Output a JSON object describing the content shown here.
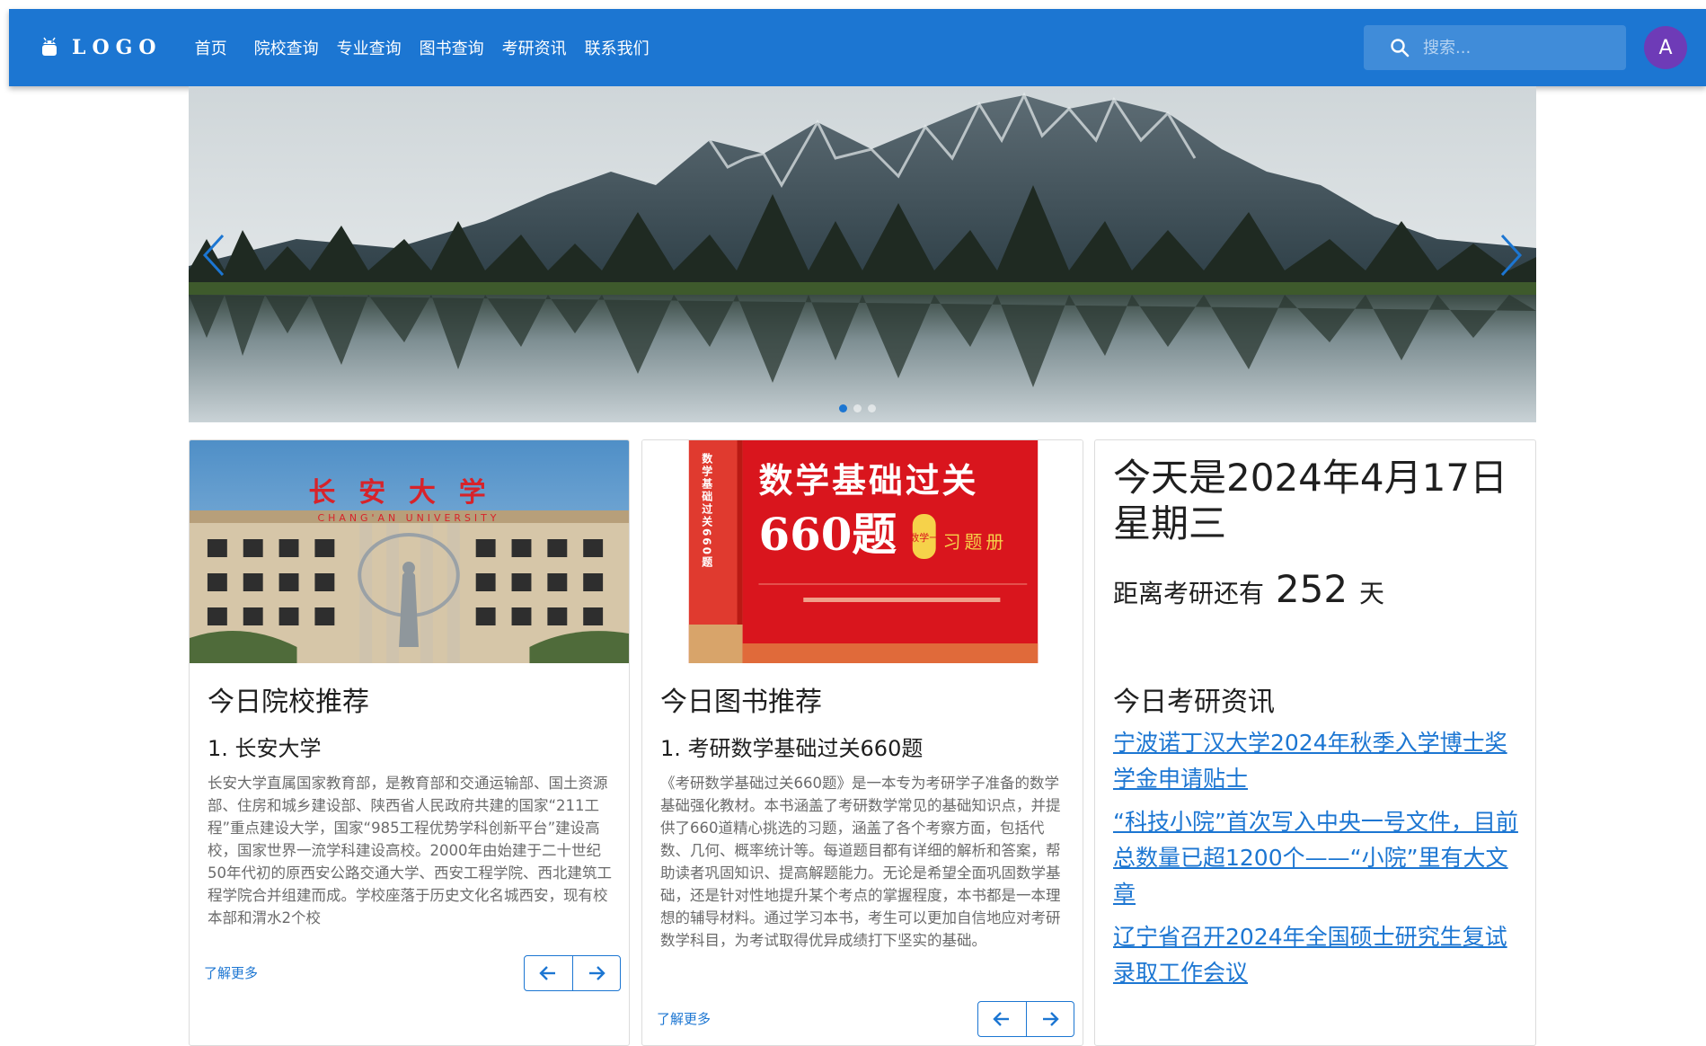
{
  "header": {
    "logo_text": "LOGO",
    "nav": [
      "首页",
      "院校查询",
      "专业查询",
      "图书查询",
      "考研资讯",
      "联系我们"
    ],
    "search_placeholder": "搜索...",
    "avatar_initial": "A"
  },
  "carousel": {
    "slide_count": 3,
    "active_slide": 1
  },
  "school_card": {
    "title": "今日院校推荐",
    "item_title": "1. 长安大学",
    "sign_text": "长安大学",
    "sign_text_en": "CHANG'AN UNIVERSITY",
    "description": "长安大学直属国家教育部，是教育部和交通运输部、国土资源部、住房和城乡建设部、陕西省人民政府共建的国家“211工程”重点建设大学，国家“985工程优势学科创新平台”建设高校，国家世界一流学科建设高校。2000年由始建于二十世纪50年代初的原西安公路交通大学、西安工程学院、西北建筑工程学院合并组建而成。学校座落于历史文化名城西安，现有校本部和渭水2个校",
    "more": "了解更多"
  },
  "book_card": {
    "title": "今日图书推荐",
    "item_title": "1. 考研数学基础过关660题",
    "cover_title": "数学基础过关",
    "cover_number": "660题",
    "cover_badge": "数学一",
    "cover_subtitle": "习题册",
    "spine_text": "数学基础过关660题",
    "description": "《考研数学基础过关660题》是一本专为考研学子准备的数学基础强化教材。本书涵盖了考研数学常见的基础知识点，并提供了660道精心挑选的习题，涵盖了各个考察方面，包括代数、几何、概率统计等。每道题目都有详细的解析和答案，帮助读者巩固知识、提高解题能力。无论是希望全面巩固数学基础，还是针对性地提升某个考点的掌握程度，本书都是一本理想的辅导材料。通过学习本书，考生可以更加自信地应对考研数学科目，为考试取得优异成绩打下坚实的基础。",
    "more": "了解更多"
  },
  "info_card": {
    "date_text": "今天是2024年4月17日 星期三",
    "countdown_prefix": "距离考研还有",
    "countdown_days": "252",
    "countdown_suffix": "天",
    "news_title": "今日考研资讯",
    "news": [
      "宁波诺丁汉大学2024年秋季入学博士奖学金申请贴士",
      "“科技小院”首次写入中央一号文件，目前总数量已超1200个——“小院”里有大文章",
      "辽宁省召开2024年全国硕士研究生复试录取工作会议"
    ]
  },
  "colors": {
    "primary": "#1c76d2",
    "avatar": "#6e3bb7",
    "book_red": "#d9151d"
  },
  "icons": [
    "android-logo-icon",
    "search-icon",
    "chevron-left-icon",
    "chevron-right-icon",
    "arrow-left-icon",
    "arrow-right-icon"
  ]
}
